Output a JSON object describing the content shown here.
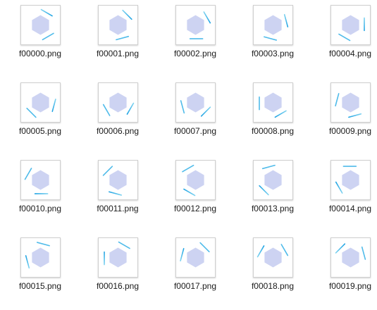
{
  "window": {
    "background": "#ffffff"
  },
  "icon_style": {
    "hexagon_fill": "#cdd3f2",
    "arc_colors": [
      "#7fd3f0",
      "#1fa3e3"
    ]
  },
  "files": [
    {
      "name": "f00000.png",
      "rotation_deg": 0
    },
    {
      "name": "f00001.png",
      "rotation_deg": 15
    },
    {
      "name": "f00002.png",
      "rotation_deg": 30
    },
    {
      "name": "f00003.png",
      "rotation_deg": 45
    },
    {
      "name": "f00004.png",
      "rotation_deg": 60
    },
    {
      "name": "f00005.png",
      "rotation_deg": 75
    },
    {
      "name": "f00006.png",
      "rotation_deg": 90
    },
    {
      "name": "f00007.png",
      "rotation_deg": 105
    },
    {
      "name": "f00008.png",
      "rotation_deg": 120
    },
    {
      "name": "f00009.png",
      "rotation_deg": 135
    },
    {
      "name": "f00010.png",
      "rotation_deg": 150
    },
    {
      "name": "f00011.png",
      "rotation_deg": 165
    },
    {
      "name": "f00012.png",
      "rotation_deg": 180
    },
    {
      "name": "f00013.png",
      "rotation_deg": 195
    },
    {
      "name": "f00014.png",
      "rotation_deg": 210
    },
    {
      "name": "f00015.png",
      "rotation_deg": 225
    },
    {
      "name": "f00016.png",
      "rotation_deg": 240
    },
    {
      "name": "f00017.png",
      "rotation_deg": 255
    },
    {
      "name": "f00018.png",
      "rotation_deg": 270
    },
    {
      "name": "f00019.png",
      "rotation_deg": 285
    }
  ]
}
